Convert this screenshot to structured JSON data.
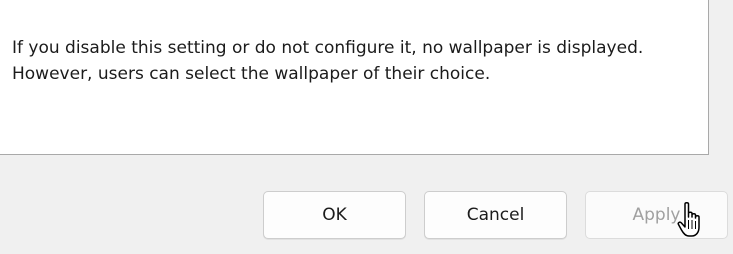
{
  "description_panel": {
    "text": "If you disable this setting or do not configure it, no wallpaper is displayed. However, users can select the wallpaper of their choice."
  },
  "buttons": {
    "ok_label": "OK",
    "cancel_label": "Cancel",
    "apply_label": "Apply"
  },
  "cursor": {
    "icon": "hand-pointer-cursor-icon"
  }
}
